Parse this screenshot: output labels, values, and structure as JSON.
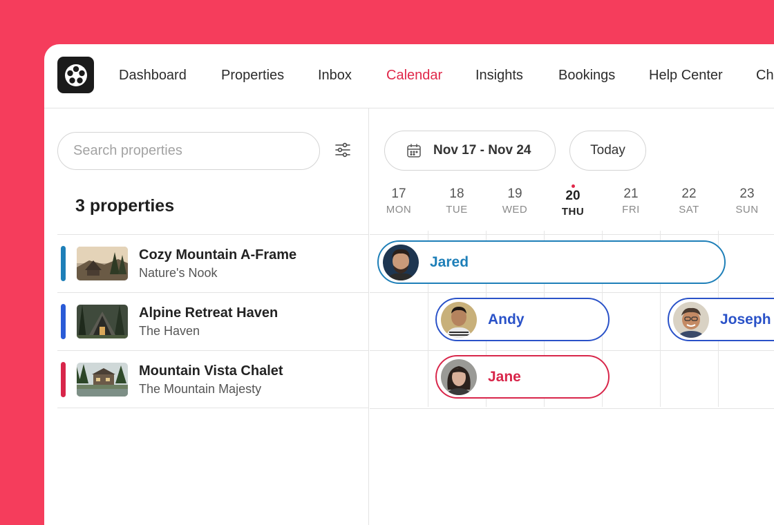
{
  "nav": {
    "items": [
      {
        "label": "Dashboard",
        "active": false
      },
      {
        "label": "Properties",
        "active": false
      },
      {
        "label": "Inbox",
        "active": false
      },
      {
        "label": "Calendar",
        "active": true
      },
      {
        "label": "Insights",
        "active": false
      },
      {
        "label": "Bookings",
        "active": false
      },
      {
        "label": "Help Center",
        "active": false
      },
      {
        "label": "Ch",
        "active": false
      }
    ]
  },
  "sidebar": {
    "search_placeholder": "Search properties",
    "count_label": "3 properties",
    "properties": [
      {
        "name": "Cozy Mountain A-Frame",
        "subtitle": "Nature's Nook",
        "color": "#1e7fb8"
      },
      {
        "name": "Alpine Retreat Haven",
        "subtitle": "The Haven",
        "color": "#2a5bd7"
      },
      {
        "name": "Mountain Vista Chalet",
        "subtitle": "The Mountain Majesty",
        "color": "#d8264a"
      }
    ]
  },
  "calendar": {
    "date_range": "Nov 17 - Nov 24",
    "today_label": "Today",
    "days": [
      {
        "num": "17",
        "dow": "MON",
        "today": false
      },
      {
        "num": "18",
        "dow": "TUE",
        "today": false
      },
      {
        "num": "19",
        "dow": "WED",
        "today": false
      },
      {
        "num": "20",
        "dow": "THU",
        "today": true
      },
      {
        "num": "21",
        "dow": "FRI",
        "today": false
      },
      {
        "num": "22",
        "dow": "SAT",
        "today": false
      },
      {
        "num": "23",
        "dow": "SUN",
        "today": false
      }
    ],
    "bookings": [
      {
        "guest": "Jared",
        "property": 0,
        "color": "#1e7fb8"
      },
      {
        "guest": "Andy",
        "property": 1,
        "color": "#2a52c8"
      },
      {
        "guest": "Joseph",
        "property": 1,
        "color": "#2a52c8"
      },
      {
        "guest": "Jane",
        "property": 2,
        "color": "#d8264a"
      }
    ]
  },
  "colors": {
    "brand": "#f53d5c",
    "accent": "#e0284a"
  }
}
